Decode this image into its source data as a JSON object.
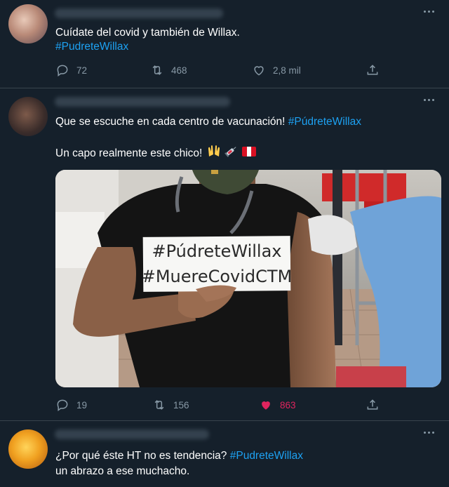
{
  "tweets": [
    {
      "lines": [
        [
          {
            "text": "Cuídate del covid y también de Willax.",
            "tag": false
          }
        ],
        [
          {
            "text": "#PudreteWillax",
            "tag": true
          }
        ]
      ],
      "stats": {
        "replies": "72",
        "retweets": "468",
        "likes": "2,8 mil",
        "liked": false
      }
    },
    {
      "lines": [
        [
          {
            "text": "Que se escuche en cada centro de vacunación! ",
            "tag": false
          },
          {
            "text": "#PúdreteWillax",
            "tag": true
          }
        ],
        [
          {
            "text": "",
            "tag": false
          }
        ],
        [
          {
            "text": "Un capo realmente este chico! ",
            "tag": false
          }
        ]
      ],
      "emoji": [
        "raised-hands",
        "syringe",
        "flag-peru"
      ],
      "image": {
        "sign_line1": "#PúdreteWillax",
        "sign_line2": "#MuereCovidCTM"
      },
      "stats": {
        "replies": "19",
        "retweets": "156",
        "likes": "863",
        "liked": true
      }
    },
    {
      "lines": [
        [
          {
            "text": "¿Por qué éste HT no es tendencia? ",
            "tag": false
          },
          {
            "text": "#PudreteWillax",
            "tag": true
          }
        ],
        [
          {
            "text": "un abrazo a ese muchacho.",
            "tag": false
          }
        ]
      ]
    }
  ],
  "colors": {
    "background": "#15202b",
    "link": "#1da1f2",
    "muted": "#8899a6",
    "like": "#e0245e",
    "border": "#38444d"
  }
}
